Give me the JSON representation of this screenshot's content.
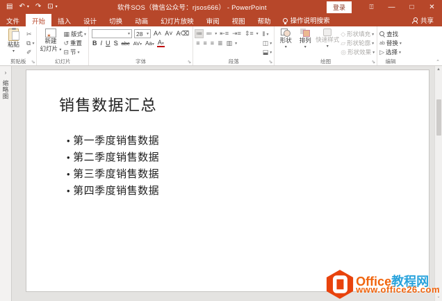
{
  "titlebar": {
    "title": "软件SOS（微信公众号：rjsos666） - PowerPoint",
    "sign_in_label": "登录",
    "minimize": "—",
    "maximize": "□",
    "close": "✕"
  },
  "tabs": {
    "file": "文件",
    "home": "开始",
    "insert": "插入",
    "design": "设计",
    "transitions": "切换",
    "animations": "动画",
    "slideshow": "幻灯片放映",
    "review": "审阅",
    "view": "视图",
    "help": "帮助",
    "tell_me": "操作说明搜索",
    "share": "共享"
  },
  "ribbon": {
    "clipboard": {
      "paste": "粘贴",
      "label": "剪贴板"
    },
    "slides": {
      "new_slide_line1": "新建",
      "new_slide_line2": "幻灯片",
      "layout": "版式",
      "reset": "重置",
      "section": "节",
      "label": "幻灯片"
    },
    "font": {
      "name_value": "",
      "size_value": "28",
      "bold": "B",
      "italic": "I",
      "underline": "U",
      "shadow": "S",
      "strikethrough": "abc",
      "spacing": "AV",
      "case": "Aa",
      "color": "A",
      "label": "字体"
    },
    "paragraph": {
      "label": "段落"
    },
    "drawing": {
      "shapes": "形状",
      "arrange": "排列",
      "quick_styles": "快速样式",
      "fill": "形状填充",
      "outline": "形状轮廓",
      "effects": "形状效果",
      "label": "绘图"
    },
    "editing": {
      "find": "查找",
      "replace": "替换",
      "select": "选择",
      "label": "编辑"
    }
  },
  "thumbnail_pane": {
    "vertical_label": "缩略图"
  },
  "slide": {
    "title": "销售数据汇总",
    "bullets": [
      "第一季度销售数据",
      "第二季度销售数据",
      "第三季度销售数据",
      "第四季度销售数据"
    ]
  },
  "watermark": {
    "brand_office": "Office",
    "brand_suffix": "教程网",
    "url": "www.office26.com"
  },
  "colors": {
    "accent": "#B7472A",
    "logo_orange": "#E8430D",
    "brand_blue": "#29A3DC"
  }
}
